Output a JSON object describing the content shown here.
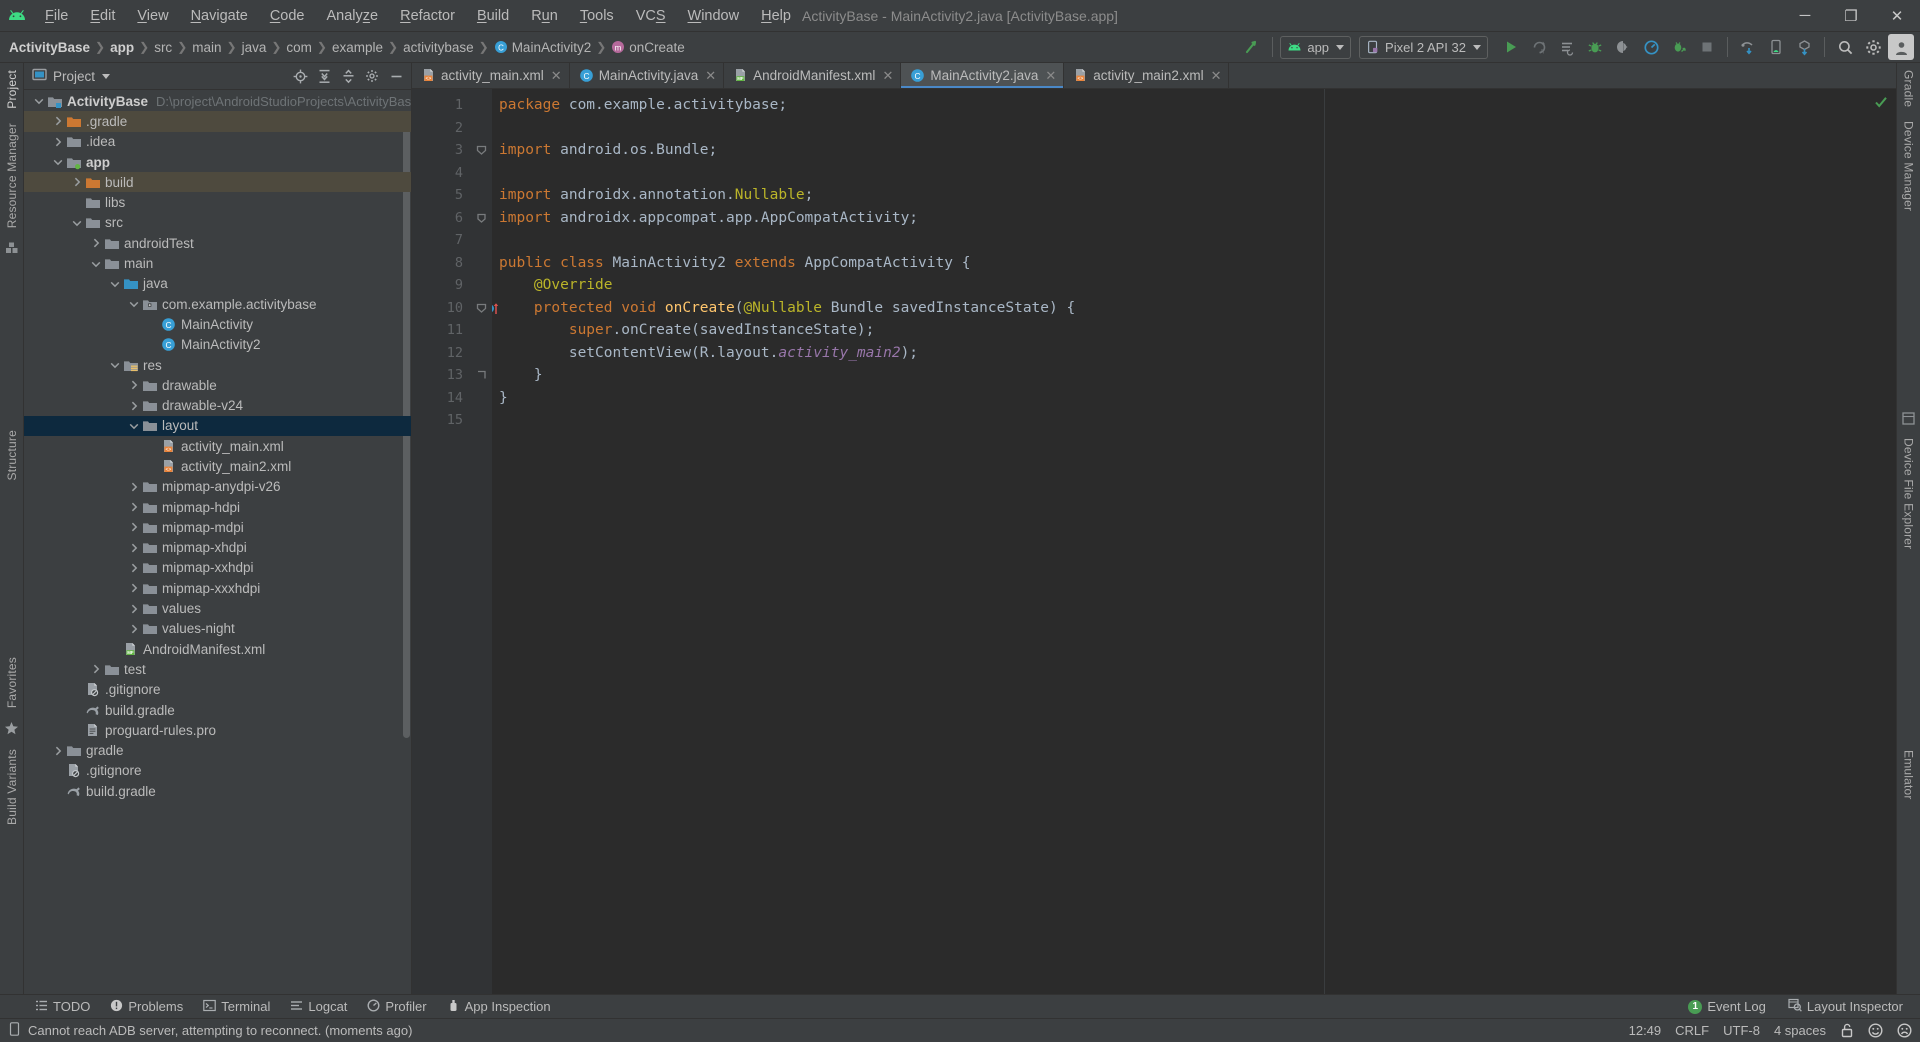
{
  "window": {
    "title": "ActivityBase - MainActivity2.java [ActivityBase.app]",
    "minimize": "─",
    "maximize": "❐",
    "close": "✕"
  },
  "menu": [
    {
      "label": "File"
    },
    {
      "label": "Edit"
    },
    {
      "label": "View"
    },
    {
      "label": "Navigate"
    },
    {
      "label": "Code"
    },
    {
      "label": "Analyze"
    },
    {
      "label": "Refactor"
    },
    {
      "label": "Build"
    },
    {
      "label": "Run"
    },
    {
      "label": "Tools"
    },
    {
      "label": "VCS"
    },
    {
      "label": "Window"
    },
    {
      "label": "Help"
    }
  ],
  "breadcrumb": [
    {
      "label": "ActivityBase",
      "bold": true
    },
    {
      "label": "app",
      "bold": true
    },
    {
      "label": "src"
    },
    {
      "label": "main"
    },
    {
      "label": "java"
    },
    {
      "label": "com"
    },
    {
      "label": "example"
    },
    {
      "label": "activitybase"
    },
    {
      "label": "MainActivity2",
      "icon": "class-icon"
    },
    {
      "label": "onCreate",
      "icon": "method-icon"
    }
  ],
  "toolbar": {
    "module_selector": "app",
    "device_selector": "Pixel 2 API 32",
    "run_tooltip": "Run",
    "icons": [
      "run-icon",
      "apply-changes-icon",
      "apply-code-changes-icon",
      "debug-icon",
      "attach-debugger-icon",
      "profiler-icon",
      "run-with-coverage-icon",
      "stop-icon",
      "device-manager-icon",
      "device-file-explorer-icon",
      "sdk-manager-icon",
      "search-icon",
      "settings-icon",
      "avatar-icon"
    ]
  },
  "project_panel": {
    "title": "Project",
    "header_icons": [
      "select-opened-file-icon",
      "expand-all-icon",
      "collapse-all-icon",
      "settings-icon",
      "hide-icon"
    ],
    "tree": [
      {
        "label": "ActivityBase",
        "path": "D:\\project\\AndroidStudioProjects\\ActivityBas",
        "indent": 0,
        "arrow": "down",
        "icon": "module-folder",
        "bold": true,
        "state": "normal"
      },
      {
        "label": ".gradle",
        "indent": 1,
        "arrow": "right",
        "icon": "orange-folder",
        "state": "dim"
      },
      {
        "label": ".idea",
        "indent": 1,
        "arrow": "right",
        "icon": "folder",
        "state": "normal"
      },
      {
        "label": "app",
        "indent": 1,
        "arrow": "down",
        "icon": "module-folder-green",
        "bold": true,
        "state": "normal"
      },
      {
        "label": "build",
        "indent": 2,
        "arrow": "right",
        "icon": "orange-folder",
        "state": "dim"
      },
      {
        "label": "libs",
        "indent": 2,
        "arrow": "none",
        "icon": "folder",
        "state": "normal"
      },
      {
        "label": "src",
        "indent": 2,
        "arrow": "down",
        "icon": "folder",
        "state": "normal"
      },
      {
        "label": "androidTest",
        "indent": 3,
        "arrow": "right",
        "icon": "folder",
        "state": "normal"
      },
      {
        "label": "main",
        "indent": 3,
        "arrow": "down",
        "icon": "folder",
        "state": "normal"
      },
      {
        "label": "java",
        "indent": 4,
        "arrow": "down",
        "icon": "source-folder",
        "state": "normal"
      },
      {
        "label": "com.example.activitybase",
        "indent": 5,
        "arrow": "down",
        "icon": "package",
        "state": "normal"
      },
      {
        "label": "MainActivity",
        "indent": 6,
        "arrow": "none",
        "icon": "class",
        "state": "normal"
      },
      {
        "label": "MainActivity2",
        "indent": 6,
        "arrow": "none",
        "icon": "class",
        "state": "normal"
      },
      {
        "label": "res",
        "indent": 4,
        "arrow": "down",
        "icon": "res-folder",
        "state": "normal"
      },
      {
        "label": "drawable",
        "indent": 5,
        "arrow": "right",
        "icon": "folder",
        "state": "normal"
      },
      {
        "label": "drawable-v24",
        "indent": 5,
        "arrow": "right",
        "icon": "folder",
        "state": "normal"
      },
      {
        "label": "layout",
        "indent": 5,
        "arrow": "down",
        "icon": "folder",
        "state": "selected"
      },
      {
        "label": "activity_main.xml",
        "indent": 6,
        "arrow": "none",
        "icon": "xml-layout",
        "state": "normal"
      },
      {
        "label": "activity_main2.xml",
        "indent": 6,
        "arrow": "none",
        "icon": "xml-layout",
        "state": "normal"
      },
      {
        "label": "mipmap-anydpi-v26",
        "indent": 5,
        "arrow": "right",
        "icon": "folder",
        "state": "normal"
      },
      {
        "label": "mipmap-hdpi",
        "indent": 5,
        "arrow": "right",
        "icon": "folder",
        "state": "normal"
      },
      {
        "label": "mipmap-mdpi",
        "indent": 5,
        "arrow": "right",
        "icon": "folder",
        "state": "normal"
      },
      {
        "label": "mipmap-xhdpi",
        "indent": 5,
        "arrow": "right",
        "icon": "folder",
        "state": "normal"
      },
      {
        "label": "mipmap-xxhdpi",
        "indent": 5,
        "arrow": "right",
        "icon": "folder",
        "state": "normal"
      },
      {
        "label": "mipmap-xxxhdpi",
        "indent": 5,
        "arrow": "right",
        "icon": "folder",
        "state": "normal"
      },
      {
        "label": "values",
        "indent": 5,
        "arrow": "right",
        "icon": "folder",
        "state": "normal"
      },
      {
        "label": "values-night",
        "indent": 5,
        "arrow": "right",
        "icon": "folder",
        "state": "normal"
      },
      {
        "label": "AndroidManifest.xml",
        "indent": 4,
        "arrow": "none",
        "icon": "manifest",
        "state": "normal"
      },
      {
        "label": "test",
        "indent": 3,
        "arrow": "right",
        "icon": "folder",
        "state": "normal"
      },
      {
        "label": ".gitignore",
        "indent": 2,
        "arrow": "none",
        "icon": "gitignore",
        "state": "normal"
      },
      {
        "label": "build.gradle",
        "indent": 2,
        "arrow": "none",
        "icon": "gradle",
        "state": "normal"
      },
      {
        "label": "proguard-rules.pro",
        "indent": 2,
        "arrow": "none",
        "icon": "text-file",
        "state": "normal"
      },
      {
        "label": "gradle",
        "indent": 1,
        "arrow": "right",
        "icon": "folder",
        "state": "normal"
      },
      {
        "label": ".gitignore",
        "indent": 1,
        "arrow": "none",
        "icon": "gitignore",
        "state": "normal"
      },
      {
        "label": "build.gradle",
        "indent": 1,
        "arrow": "none",
        "icon": "gradle",
        "state": "normal"
      }
    ]
  },
  "left_strip": [
    {
      "label": "Project",
      "active": true
    },
    {
      "label": "Resource Manager",
      "active": false
    },
    {
      "label": "Structure",
      "active": false
    },
    {
      "label": "Favorites",
      "active": false
    },
    {
      "label": "Build Variants",
      "active": false
    }
  ],
  "right_strip": [
    {
      "label": "Gradle"
    },
    {
      "label": "Device Manager"
    },
    {
      "label": "Device File Explorer"
    },
    {
      "label": "Emulator"
    }
  ],
  "editor_tabs": [
    {
      "label": "activity_main.xml",
      "icon": "xml-layout",
      "active": false
    },
    {
      "label": "MainActivity.java",
      "icon": "class",
      "active": false
    },
    {
      "label": "AndroidManifest.xml",
      "icon": "manifest",
      "active": false
    },
    {
      "label": "MainActivity2.java",
      "icon": "class",
      "active": true
    },
    {
      "label": "activity_main2.xml",
      "icon": "xml-layout",
      "active": false
    }
  ],
  "code": {
    "line_numbers": [
      "1",
      "2",
      "3",
      "4",
      "5",
      "6",
      "7",
      "8",
      "9",
      "10",
      "11",
      "12",
      "13",
      "14",
      "15"
    ],
    "lines": [
      [
        {
          "t": "package",
          "c": "kw"
        },
        {
          "t": " com.example.activitybase;",
          "c": "txt"
        }
      ],
      [],
      [
        {
          "t": "import",
          "c": "kw"
        },
        {
          "t": " android.os.Bundle;",
          "c": "txt"
        }
      ],
      [],
      [
        {
          "t": "import",
          "c": "kw"
        },
        {
          "t": " androidx.annotation.",
          "c": "txt"
        },
        {
          "t": "Nullable",
          "c": "ann"
        },
        {
          "t": ";",
          "c": "txt"
        }
      ],
      [
        {
          "t": "import",
          "c": "kw"
        },
        {
          "t": " androidx.appcompat.app.AppCompatActivity;",
          "c": "txt"
        }
      ],
      [],
      [
        {
          "t": "public class",
          "c": "kw"
        },
        {
          "t": " MainActivity2 ",
          "c": "txt"
        },
        {
          "t": "extends",
          "c": "kw"
        },
        {
          "t": " AppCompatActivity {",
          "c": "txt"
        }
      ],
      [
        {
          "t": "    @Override",
          "c": "ann"
        }
      ],
      [
        {
          "t": "    protected void",
          "c": "kw"
        },
        {
          "t": " ",
          "c": "txt"
        },
        {
          "t": "onCreate",
          "c": "fn"
        },
        {
          "t": "(",
          "c": "txt"
        },
        {
          "t": "@Nullable",
          "c": "ann"
        },
        {
          "t": " Bundle savedInstanceState) {",
          "c": "txt"
        }
      ],
      [
        {
          "t": "        ",
          "c": "txt"
        },
        {
          "t": "super",
          "c": "kw"
        },
        {
          "t": ".onCreate(savedInstanceState);",
          "c": "txt"
        }
      ],
      [
        {
          "t": "        setContentView(R.layout.",
          "c": "txt"
        },
        {
          "t": "activity_main2",
          "c": "fld"
        },
        {
          "t": ");",
          "c": "txt"
        }
      ],
      [
        {
          "t": "    }",
          "c": "txt"
        }
      ],
      [
        {
          "t": "}",
          "c": "txt"
        }
      ],
      []
    ],
    "gutter_marks": {
      "10": "override-method-marker"
    },
    "fold_lines": [
      3,
      6,
      10,
      13
    ],
    "inspection_status": "ok"
  },
  "bottom_tools": [
    {
      "label": "TODO",
      "icon": "todo-icon"
    },
    {
      "label": "Problems",
      "icon": "problems-icon"
    },
    {
      "label": "Terminal",
      "icon": "terminal-icon"
    },
    {
      "label": "Logcat",
      "icon": "logcat-icon"
    },
    {
      "label": "Profiler",
      "icon": "profiler-icon"
    },
    {
      "label": "App Inspection",
      "icon": "app-inspection-icon"
    }
  ],
  "bottom_right": [
    {
      "label": "Event Log",
      "badge": "1",
      "icon": "event-log-icon"
    },
    {
      "label": "Layout Inspector",
      "badge": "",
      "icon": "layout-inspector-icon"
    }
  ],
  "status_bar": {
    "message": "Cannot reach ADB server, attempting to reconnect. (moments ago)",
    "caret_position": "12:49",
    "line_separator": "CRLF",
    "encoding": "UTF-8",
    "indent": "4 spaces",
    "lock_icon": "unlocked-icon",
    "happy_icon": "☺",
    "sad_icon": "☹"
  },
  "colors": {
    "accent_green": "#499c54",
    "accent_blue": "#3592c4",
    "selection_blue": "#0d293e",
    "editor_bg": "#2b2b2b",
    "panel_bg": "#3c3f41",
    "keyword_orange": "#cc7832",
    "annotation_yellow": "#bbb529",
    "method_gold": "#ffc66d",
    "field_purple": "#9876aa",
    "text_default": "#a9b7c6"
  }
}
